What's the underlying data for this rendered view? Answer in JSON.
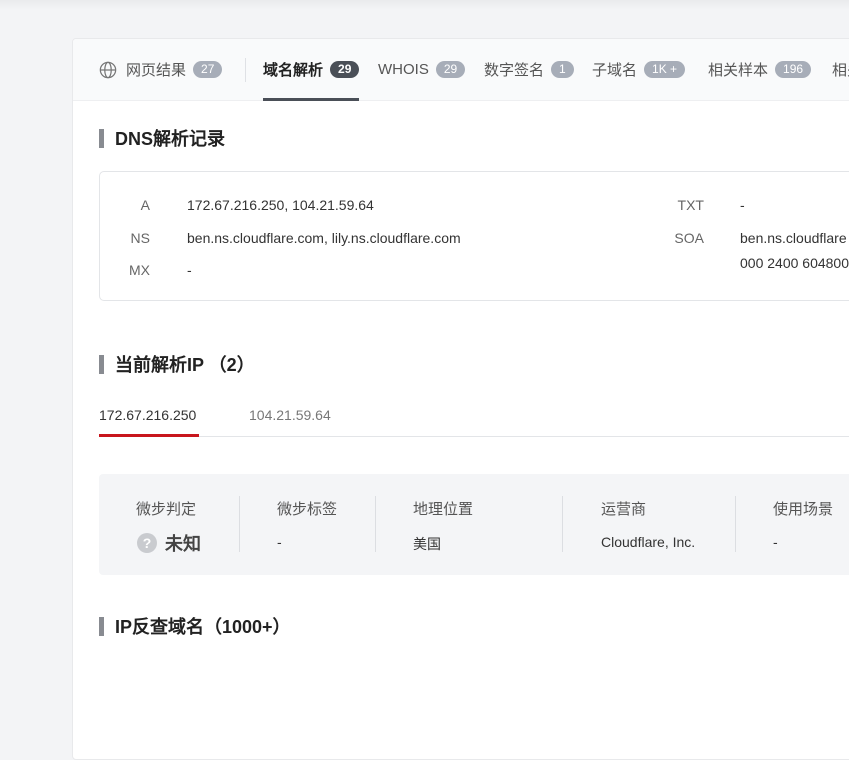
{
  "tabs": [
    {
      "label": "网页结果",
      "count": "27"
    },
    {
      "label": "域名解析",
      "count": "29"
    },
    {
      "label": "WHOIS",
      "count": "29"
    },
    {
      "label": "数字签名",
      "count": "1"
    },
    {
      "label": "子域名",
      "count": "1K +"
    },
    {
      "label": "相关样本",
      "count": "196"
    },
    {
      "label": "相关"
    }
  ],
  "dns": {
    "title": "DNS解析记录",
    "a_key": "A",
    "a_value": "172.67.216.250, 104.21.59.64",
    "ns_key": "NS",
    "ns_value": "ben.ns.cloudflare.com, lily.ns.cloudflare.com",
    "mx_key": "MX",
    "mx_value": "-",
    "txt_key": "TXT",
    "txt_value": "-",
    "soa_key": "SOA",
    "soa_value_line1": "ben.ns.cloudflare",
    "soa_value_line2": "000 2400 604800"
  },
  "current_ip": {
    "title": "当前解析IP （2）",
    "tabs": [
      "172.67.216.250",
      "104.21.59.64"
    ]
  },
  "ip_info": {
    "judgement_label": "微步判定",
    "judgement_value": "未知",
    "tags_label": "微步标签",
    "tags_value": "-",
    "geo_label": "地理位置",
    "geo_value": "美国",
    "isp_label": "运营商",
    "isp_value": "Cloudflare, Inc.",
    "usage_label": "使用场景",
    "usage_value": "-"
  },
  "reverse": {
    "title": "IP反查域名（1000+）"
  }
}
